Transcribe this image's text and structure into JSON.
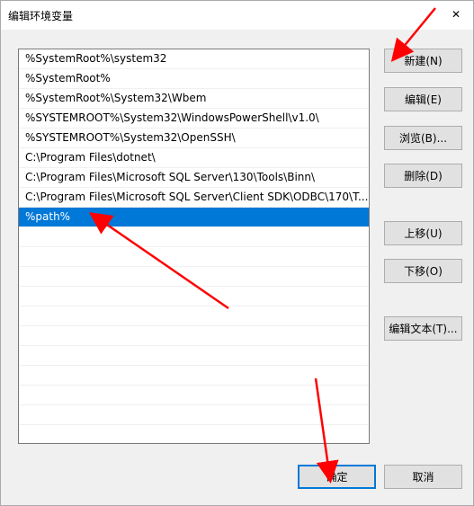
{
  "window": {
    "title": "编辑环境变量",
    "close_glyph": "✕"
  },
  "paths": [
    "%SystemRoot%\\system32",
    "%SystemRoot%",
    "%SystemRoot%\\System32\\Wbem",
    "%SYSTEMROOT%\\System32\\WindowsPowerShell\\v1.0\\",
    "%SYSTEMROOT%\\System32\\OpenSSH\\",
    "C:\\Program Files\\dotnet\\",
    "C:\\Program Files\\Microsoft SQL Server\\130\\Tools\\Binn\\",
    "C:\\Program Files\\Microsoft SQL Server\\Client SDK\\ODBC\\170\\T...",
    "%path%"
  ],
  "selected_index": 8,
  "empty_rows": 12,
  "buttons": {
    "new": "新建(N)",
    "edit": "编辑(E)",
    "browse": "浏览(B)...",
    "delete": "删除(D)",
    "move_up": "上移(U)",
    "move_down": "下移(O)",
    "edit_text": "编辑文本(T)...",
    "ok": "确定",
    "cancel": "取消"
  },
  "colors": {
    "selection": "#0078d7",
    "annotation_arrow": "#ff0000"
  }
}
